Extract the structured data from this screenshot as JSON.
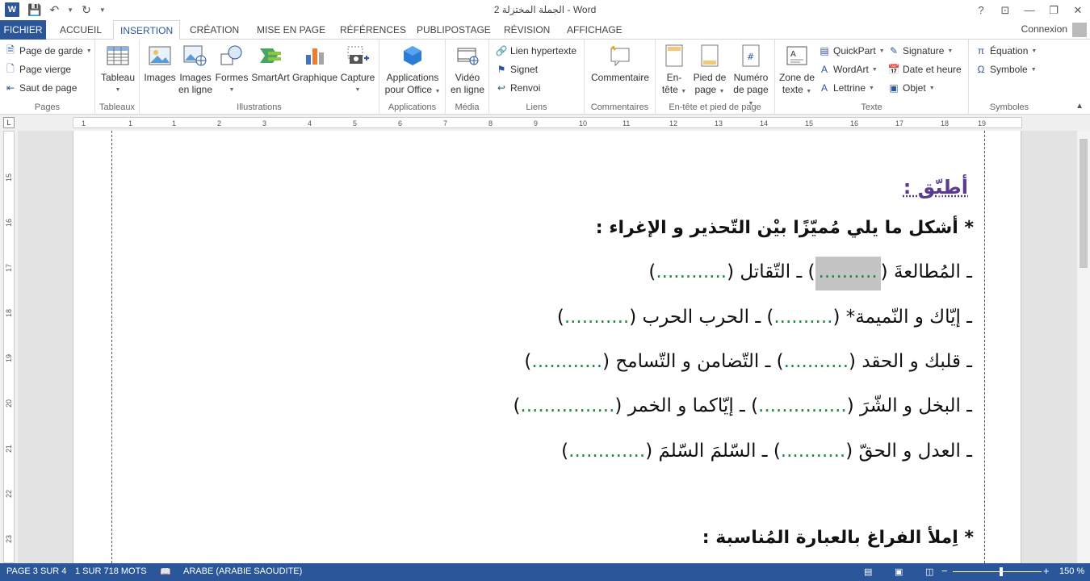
{
  "titlebar": {
    "title": "الجملة المختزلة 2 - Word",
    "help": "?",
    "restore_ribbon": "⊡",
    "minimize": "—",
    "maximize": "❐",
    "close": "✕"
  },
  "tabs": {
    "file": "FICHIER",
    "items": [
      "ACCUEIL",
      "INSERTION",
      "CRÉATION",
      "MISE EN PAGE",
      "RÉFÉRENCES",
      "PUBLIPOSTAGE",
      "RÉVISION",
      "AFFICHAGE"
    ],
    "active": "INSERTION",
    "signin": "Connexion"
  },
  "ribbon": {
    "pages": {
      "label": "Pages",
      "cover": "Page de garde",
      "blank": "Page vierge",
      "break": "Saut de page"
    },
    "tables": {
      "label": "Tableaux",
      "table": "Tableau"
    },
    "illustrations": {
      "label": "Illustrations",
      "images": "Images",
      "online_1": "Images",
      "online_2": "en ligne",
      "shapes": "Formes",
      "smartart": "SmartArt",
      "chart": "Graphique",
      "capture": "Capture"
    },
    "apps": {
      "label": "Applications",
      "btn_1": "Applications",
      "btn_2": "pour Office"
    },
    "media": {
      "label": "Média",
      "btn_1": "Vidéo",
      "btn_2": "en ligne"
    },
    "links": {
      "label": "Liens",
      "hyperlink": "Lien hypertexte",
      "bookmark": "Signet",
      "crossref": "Renvoi"
    },
    "comments": {
      "label": "Commentaires",
      "comment": "Commentaire"
    },
    "header_footer": {
      "label": "En-tête et pied de page",
      "header_1": "En-",
      "header_2": "tête",
      "footer_1": "Pied de",
      "footer_2": "page",
      "pagenum_1": "Numéro",
      "pagenum_2": "de page"
    },
    "text": {
      "label": "Texte",
      "textbox_1": "Zone de",
      "textbox_2": "texte",
      "quickpart": "QuickPart",
      "wordart": "WordArt",
      "dropcap": "Lettrine",
      "signature": "Signature",
      "datetime": "Date et heure",
      "object": "Objet"
    },
    "symbols": {
      "label": "Symboles",
      "equation": "Équation",
      "symbol": "Symbole"
    }
  },
  "ruler": {
    "corner": "L",
    "h_ticks": [
      "1",
      "1",
      "1",
      "2",
      "3",
      "4",
      "5",
      "6",
      "7",
      "8",
      "9",
      "10",
      "11",
      "12",
      "13",
      "14",
      "15",
      "16",
      "17",
      "18",
      "19"
    ],
    "v_ticks": [
      "15",
      "16",
      "17",
      "18",
      "19",
      "20",
      "21",
      "22",
      "23"
    ]
  },
  "document": {
    "heading": "أطبّق :",
    "instruction1": "* أشكل ما يلي مُميّزًا بيْن التّحذير و الإغراء :",
    "lines": [
      {
        "a": "ـ المُطالعةَ (",
        "b1": "..........",
        "m": ")  ـ التّقاتل (",
        "b2": "............",
        "e": ")"
      },
      {
        "a": "ـ إيّاك و النّميمة* (",
        "b1": "..........",
        "m": ") ـ الحرب الحرب (",
        "b2": "...........",
        "e": ")"
      },
      {
        "a": "ـ قلبك و الحقد (",
        "b1": "...........",
        "m": ") ـ التّضامن و التّسامح (",
        "b2": "............",
        "e": ")"
      },
      {
        "a": "ـ البخل و الشّرَ (",
        "b1": "...............",
        "m": ") ـ إيّاكما و الخمر (",
        "b2": "................",
        "e": ")"
      },
      {
        "a": "ـ العدل و الحقّ (",
        "b1": "...........",
        "m": ") ـ السّلمَ السّلمَ (",
        "b2": ".............",
        "e": ")"
      }
    ],
    "instruction2": "* اِملأ الفراغ بالعبارة المُناسبة :"
  },
  "statusbar": {
    "page": "PAGE 3 SUR 4",
    "words": "1 SUR 718 MOTS",
    "language": "ARABE (ARABIE SAOUDITE)",
    "zoom": "150 %",
    "zoom_minus": "−",
    "zoom_plus": "+"
  },
  "colors": {
    "accent": "#2b579a",
    "heading": "#5b3b8f",
    "blank": "#1a8a3a"
  }
}
